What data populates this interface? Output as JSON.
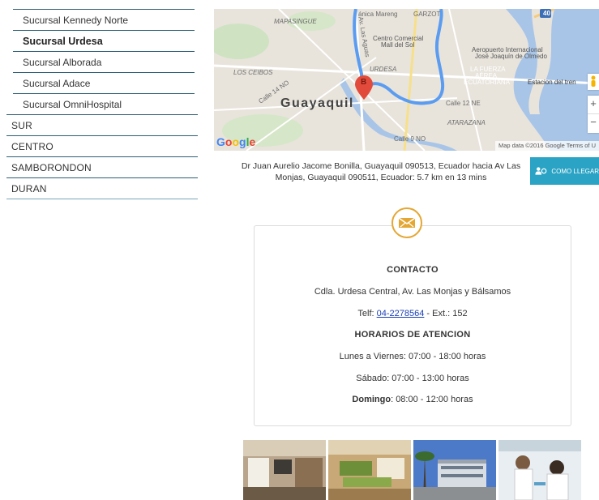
{
  "sidebar": {
    "sub_items": [
      {
        "label": "Sucursal Kennedy Norte",
        "active": false
      },
      {
        "label": "Sucursal Urdesa",
        "active": true
      },
      {
        "label": "Sucursal Alborada",
        "active": false
      },
      {
        "label": "Sucursal Adace",
        "active": false
      },
      {
        "label": "Sucursal OmniHospital",
        "active": false
      }
    ],
    "top_items": [
      "SUR",
      "CENTRO",
      "SAMBORONDON",
      "DURAN"
    ]
  },
  "map": {
    "labels": {
      "marengo": "ánica Mareng",
      "garzota": "GARZOT",
      "mapasingue": "MAPASINGUE",
      "cc_mall": "Centro Comercial",
      "cc_mall2": "Mall del Sol",
      "airport1": "Aeropuerto Internacional",
      "airport2": "José Joaquín de Olmedo",
      "lafuerza1": "LA FUERZA",
      "lafuerza2": "AÉREA",
      "lafuerza3": "ECUATORIANA",
      "tren": "Estacion del tren",
      "losceibos": "LOS CEIBOS",
      "urdesa": "URDESA",
      "calle12": "Calle 12 NE",
      "atarazana": "ATARAZANA",
      "calle9": "Calle 9 NO",
      "calle14": "Calle 14 NO",
      "lasaguas": "Av. Las Aguas",
      "marker": "B",
      "highway": "40"
    },
    "city": "Guayaquil",
    "logo": "Google",
    "footer": "Map data ©2016 Google   Terms of U",
    "zoom_in": "+",
    "zoom_out": "−"
  },
  "route": {
    "description": "Dr Juan Aurelio Jacome Bonilla, Guayaquil 090513, Ecuador hacia Av Las Monjas, Guayaquil 090511, Ecuador: 5.7 km en 13 mins",
    "button_label": "COMO LLEGAR"
  },
  "contact": {
    "heading": "CONTACTO",
    "address": "Cdla. Urdesa Central, Av. Las Monjas y Bálsamos",
    "phone_prefix": "Telf: ",
    "phone": "04-2278564",
    "phone_ext": " - Ext.: 152",
    "hours_heading": "HORARIOS DE ATENCION",
    "weekdays": "Lunes a Viernes: 07:00 - 18:00 horas",
    "saturday": "Sábado: 07:00 - 13:00 horas",
    "sunday_label": "Domingo",
    "sunday_hours": ": 08:00 - 12:00 horas"
  },
  "colors": {
    "accent": "#2aa3c4",
    "icon_gold": "#e4a733",
    "sidebar_line": "#2c5f75"
  }
}
